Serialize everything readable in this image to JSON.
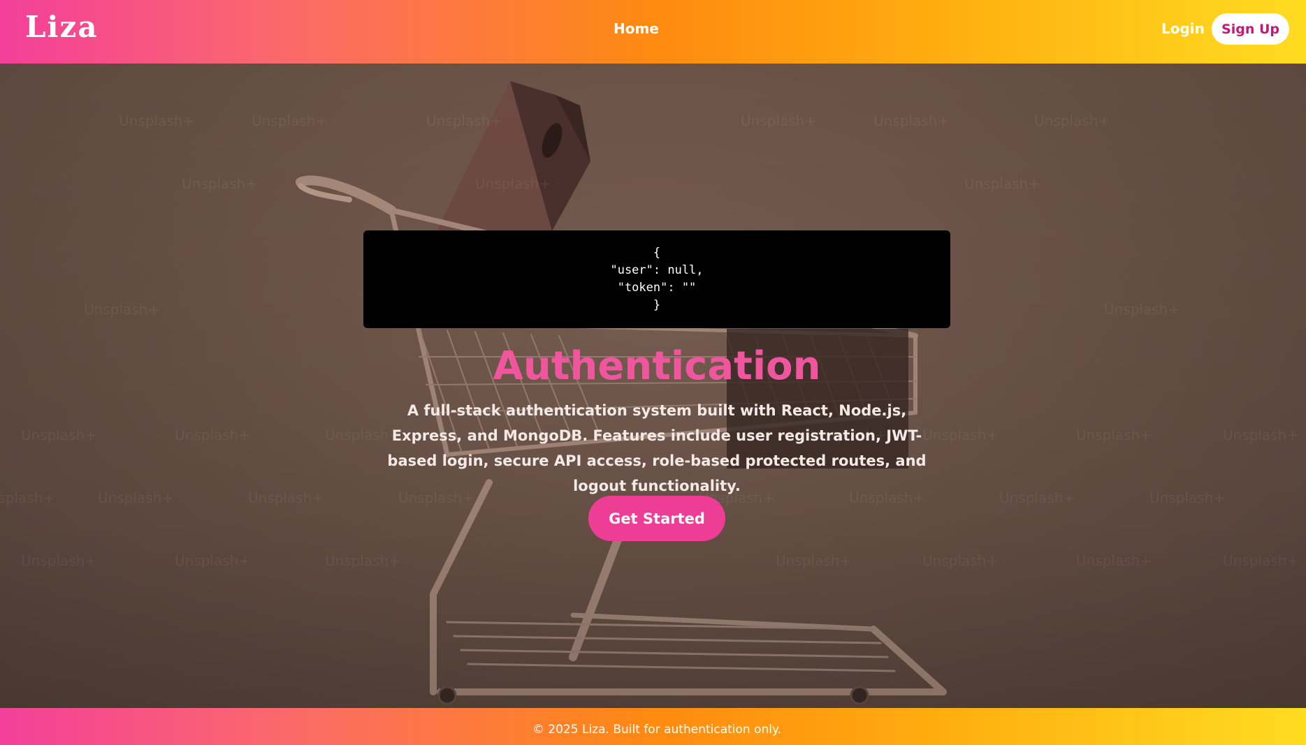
{
  "header": {
    "logo": "Liza",
    "nav_home": "Home",
    "login_label": "Login",
    "signup_label": "Sign Up"
  },
  "code_box": {
    "lines": [
      "{",
      "\"user\": null,",
      "\"token\": \"\"",
      "}"
    ]
  },
  "hero": {
    "title": "Authentication",
    "description": "A full-stack authentication system built with React, Node.js, Express, and MongoDB. Features include user registration, JWT-based login, secure API access, role-based protected routes, and logout functionality.",
    "cta_label": "Get Started",
    "watermark_text": "Unsplash+"
  },
  "footer": {
    "text": "© 2025 Liza. Built for authentication only."
  },
  "colors": {
    "brand_pink": "#ee3d94",
    "title_pink": "#f0569e",
    "signup_text": "#c21a74",
    "gradient_start": "#f43f9a",
    "gradient_mid": "#ff8a10",
    "gradient_end": "#ffdc20"
  }
}
